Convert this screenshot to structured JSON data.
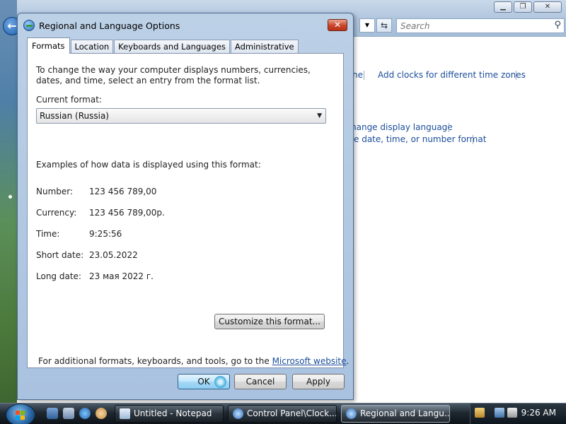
{
  "background_window": {
    "search_placeholder": "Search",
    "links": [
      "ne",
      "Add clocks for different time zones",
      "hange display language",
      "e date, time, or number format"
    ]
  },
  "dialog": {
    "title": "Regional and Language Options",
    "close_label": "✕",
    "tabs": [
      "Formats",
      "Location",
      "Keyboards and Languages",
      "Administrative"
    ],
    "description": "To change the way your computer displays numbers, currencies, dates, and time, select an entry from the format list.",
    "current_format_label": "Current format:",
    "current_format_value": "Russian (Russia)",
    "examples_heading": "Examples of how data is displayed using this format:",
    "examples": [
      {
        "label": "Number:",
        "value": "123 456 789,00"
      },
      {
        "label": "Currency:",
        "value": "123 456 789,00р."
      },
      {
        "label": "Time:",
        "value": "9:25:56"
      },
      {
        "label": "Short date:",
        "value": "23.05.2022"
      },
      {
        "label": "Long date:",
        "value": "23 мая 2022 г."
      }
    ],
    "customize_button": "Customize this format...",
    "footer_text": "For additional formats, keyboards, and tools, go to the ",
    "footer_link": "Microsoft website",
    "footer_end": ".",
    "ok_button": "OK",
    "cancel_button": "Cancel",
    "apply_button": "Apply"
  },
  "taskbar": {
    "tasks": [
      {
        "label": "Untitled - Notepad",
        "icon": "notepad-icon"
      },
      {
        "label": "Control Panel\\Clock...",
        "icon": "control-panel-icon"
      },
      {
        "label": "Regional and Langu...",
        "icon": "globe-icon"
      }
    ],
    "clock": "9:26 AM"
  }
}
